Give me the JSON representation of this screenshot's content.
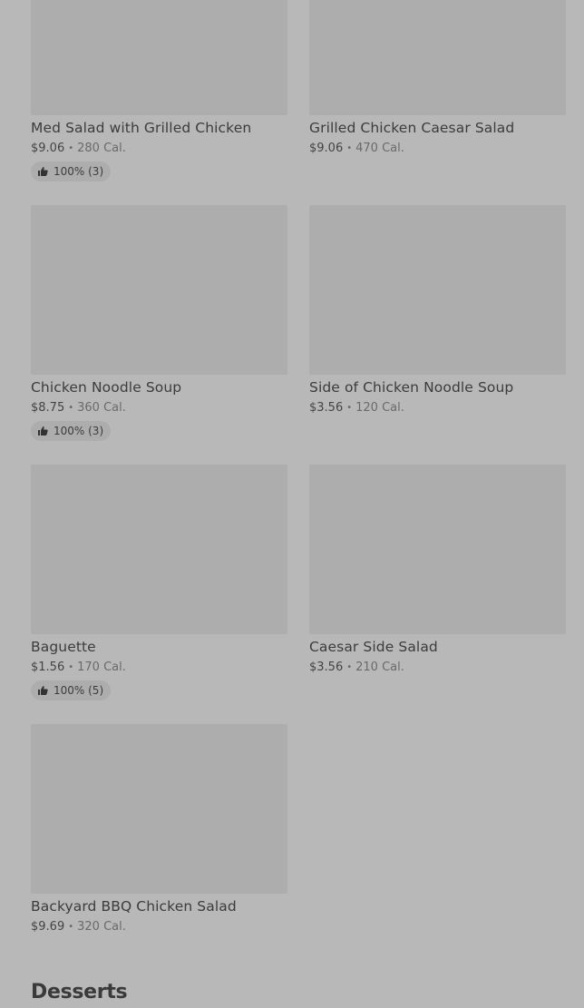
{
  "menu": {
    "items": [
      {
        "name": "Med Salad with Grilled Chicken",
        "price": "$9.06",
        "calories": "280 Cal.",
        "rating": "100% (3)"
      },
      {
        "name": "Grilled Chicken Caesar Salad",
        "price": "$9.06",
        "calories": "470 Cal.",
        "rating": null
      },
      {
        "name": "Chicken Noodle Soup",
        "price": "$8.75",
        "calories": "360 Cal.",
        "rating": "100% (3)"
      },
      {
        "name": "Side of Chicken Noodle Soup",
        "price": "$3.56",
        "calories": "120 Cal.",
        "rating": null
      },
      {
        "name": "Baguette",
        "price": "$1.56",
        "calories": "170 Cal.",
        "rating": "100% (5)"
      },
      {
        "name": "Caesar Side Salad",
        "price": "$3.56",
        "calories": "210 Cal.",
        "rating": null
      },
      {
        "name": "Backyard BBQ Chicken Salad",
        "price": "$9.69",
        "calories": "320 Cal.",
        "rating": null
      }
    ],
    "separator": "•",
    "next_section_title": "Desserts"
  },
  "icons": {
    "rating": "thumbs-up-icon"
  },
  "colors": {
    "overlay_background": "#b8b8b8",
    "image_placeholder": "#adadad",
    "text": "#3c3c3c"
  }
}
